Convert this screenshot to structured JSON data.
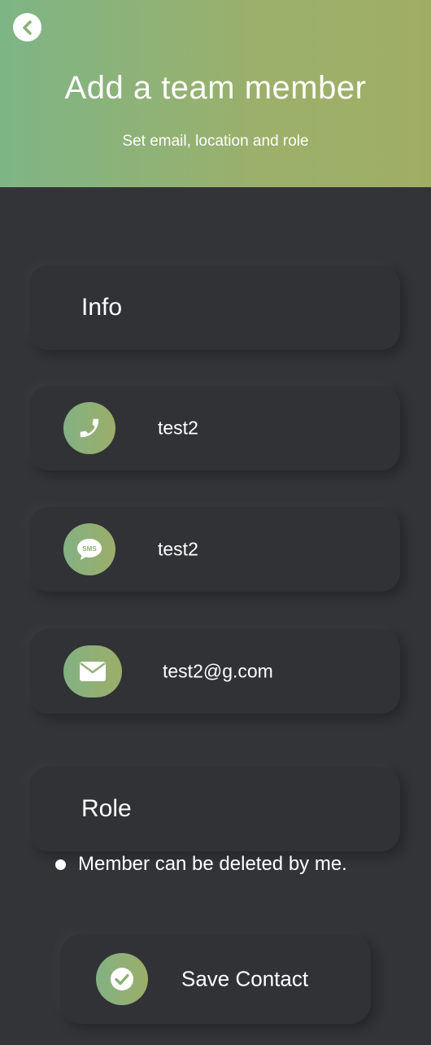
{
  "header": {
    "title": "Add a team member",
    "subtitle": "Set email, location and role"
  },
  "info_section": {
    "label": "Info"
  },
  "fields": {
    "phone": {
      "value": "test2",
      "icon": "phone-icon"
    },
    "sms": {
      "value": "test2",
      "icon": "sms-icon",
      "icon_text": "SMS"
    },
    "email": {
      "value": "test2@g.com",
      "icon": "envelope-icon"
    }
  },
  "role_section": {
    "label": "Role",
    "option_label": "Member can be deleted by me."
  },
  "save_button": {
    "label": "Save Contact",
    "icon": "check-circle-icon"
  },
  "colors": {
    "background": "#333438",
    "accent_start": "#7eb586",
    "accent_end": "#a0ae65",
    "text": "#ffffff"
  }
}
